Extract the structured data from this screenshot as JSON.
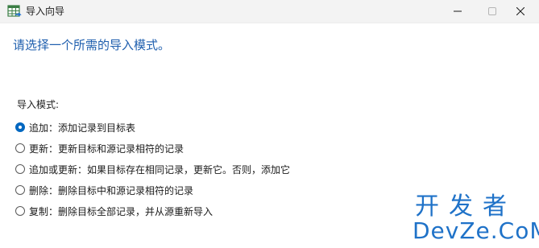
{
  "window": {
    "title": "导入向导",
    "icon": "table-import-icon",
    "controls": {
      "minimize": "minimize-icon",
      "maximize": "maximize-icon",
      "close": "close-icon"
    }
  },
  "main": {
    "heading": "请选择一个所需的导入模式。",
    "mode_label": "导入模式:",
    "options": [
      {
        "label": "追加：添加记录到目标表",
        "checked": true
      },
      {
        "label": "更新：更新目标和源记录相符的记录",
        "checked": false
      },
      {
        "label": "追加或更新：如果目标存在相同记录，更新它。否则，添加它",
        "checked": false
      },
      {
        "label": "删除：删除目标中和源记录相符的记录",
        "checked": false
      },
      {
        "label": "复制：删除目标全部记录，并从源重新导入",
        "checked": false
      }
    ]
  },
  "watermark": {
    "line1": "开发者",
    "line2": "DevZe.CoM"
  },
  "colors": {
    "accent": "#0067c0",
    "heading": "#1f5fae",
    "watermark": "#1f72c8"
  }
}
